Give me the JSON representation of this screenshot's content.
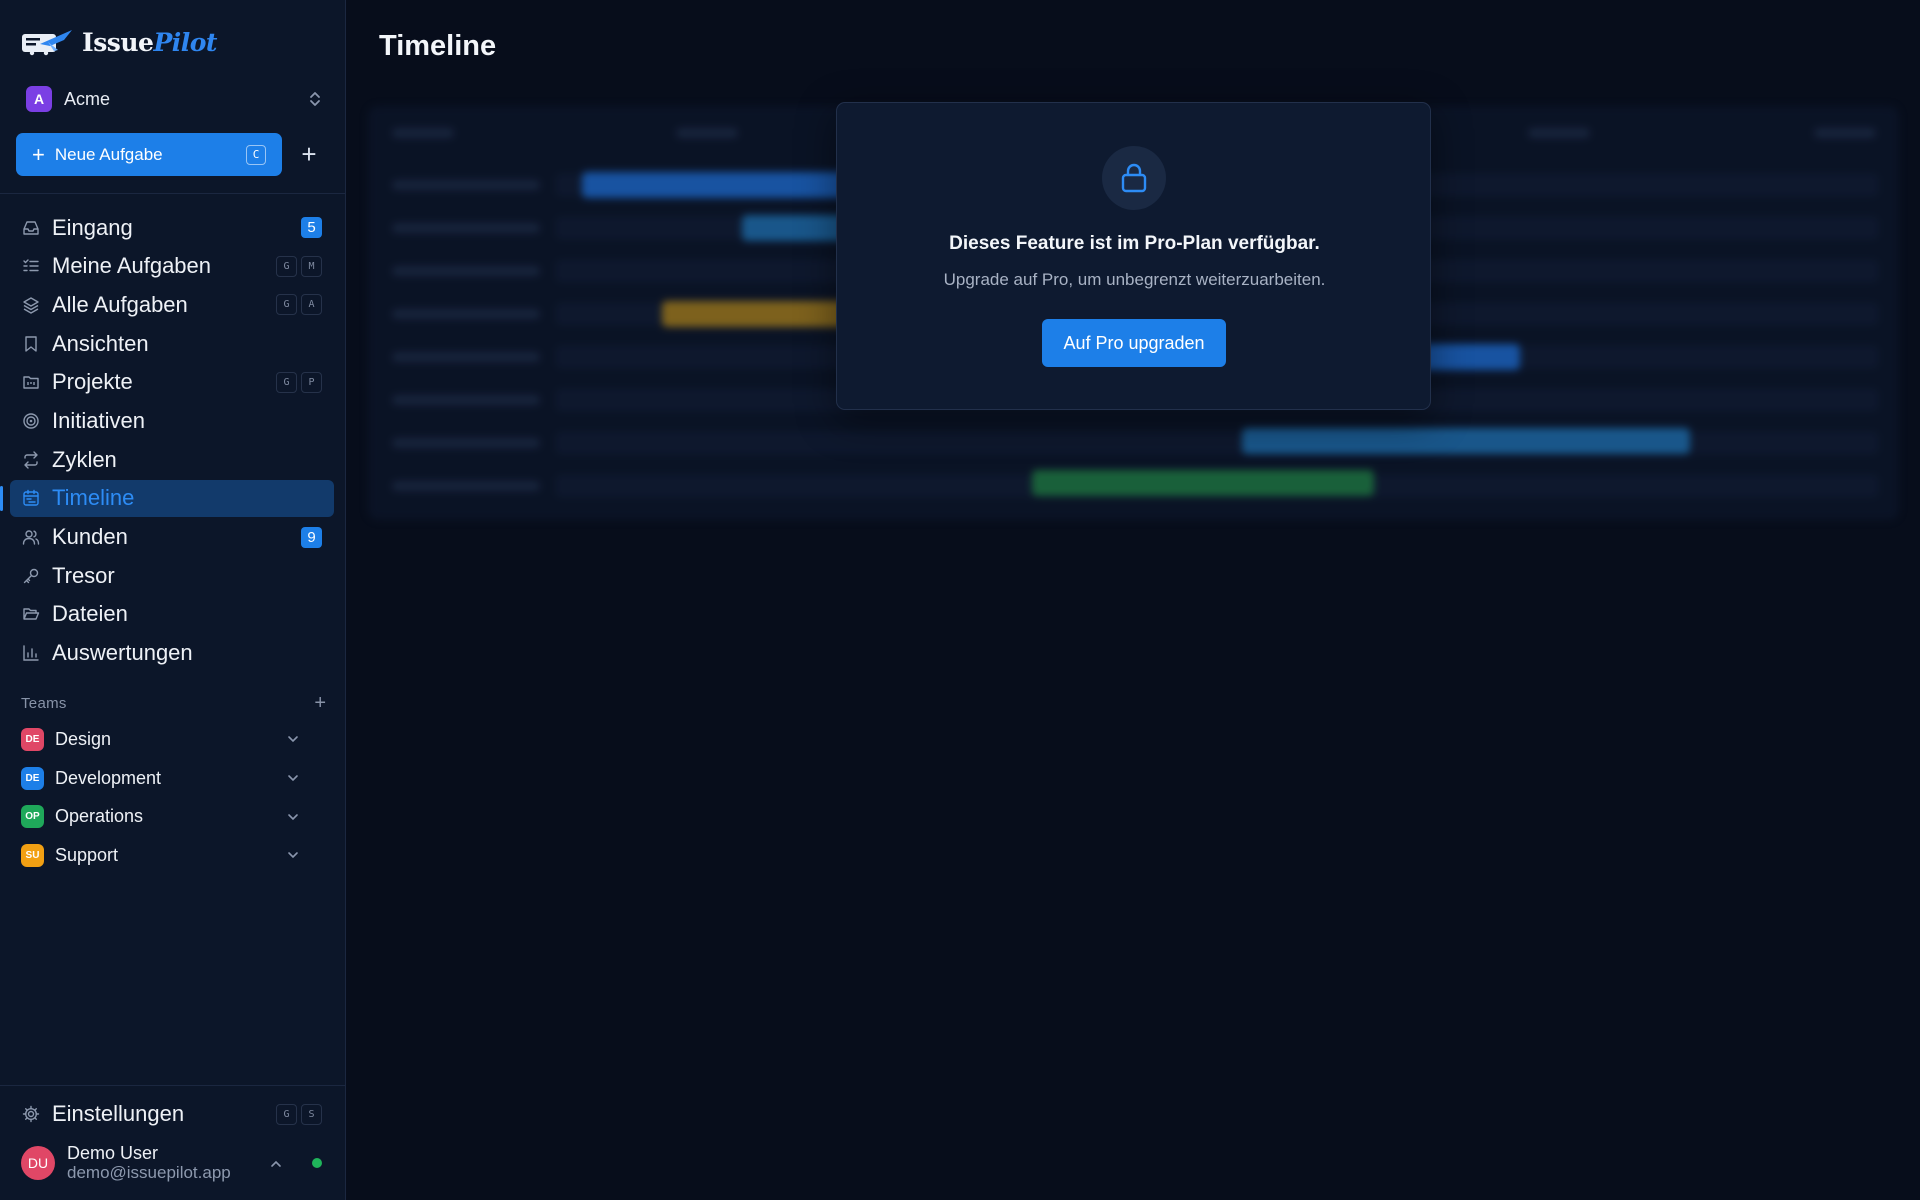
{
  "brand": {
    "name_part1": "Issue",
    "name_part2": "Pilot"
  },
  "workspace": {
    "initial": "A",
    "name": "Acme"
  },
  "new_task": {
    "label": "Neue Aufgabe",
    "shortcut": "C"
  },
  "nav": [
    {
      "id": "inbox",
      "label": "Eingang",
      "icon": "inbox-icon",
      "count": "5"
    },
    {
      "id": "my-tasks",
      "label": "Meine Aufgaben",
      "icon": "list-icon",
      "keys": [
        "G",
        "M"
      ]
    },
    {
      "id": "all-tasks",
      "label": "Alle Aufgaben",
      "icon": "layers-icon",
      "keys": [
        "G",
        "A"
      ]
    },
    {
      "id": "views",
      "label": "Ansichten",
      "icon": "bookmark-icon"
    },
    {
      "id": "projects",
      "label": "Projekte",
      "icon": "folder-kanban-icon",
      "keys": [
        "G",
        "P"
      ]
    },
    {
      "id": "initiatives",
      "label": "Initiativen",
      "icon": "target-icon"
    },
    {
      "id": "cycles",
      "label": "Zyklen",
      "icon": "repeat-icon"
    },
    {
      "id": "timeline",
      "label": "Timeline",
      "icon": "calendar-icon",
      "active": true
    },
    {
      "id": "customers",
      "label": "Kunden",
      "icon": "users-icon",
      "count": "9"
    },
    {
      "id": "vault",
      "label": "Tresor",
      "icon": "key-icon"
    },
    {
      "id": "files",
      "label": "Dateien",
      "icon": "folder-open-icon"
    },
    {
      "id": "reports",
      "label": "Auswertungen",
      "icon": "bar-chart-icon"
    }
  ],
  "teams": {
    "heading": "Teams",
    "items": [
      {
        "initials": "DE",
        "name": "Design",
        "color": "#e04766"
      },
      {
        "initials": "DE",
        "name": "Development",
        "color": "#1d7fe8"
      },
      {
        "initials": "OP",
        "name": "Operations",
        "color": "#1fa85a"
      },
      {
        "initials": "SU",
        "name": "Support",
        "color": "#f2a013"
      }
    ]
  },
  "settings": {
    "label": "Einstellungen",
    "keys": [
      "G",
      "S"
    ]
  },
  "user": {
    "initials": "DU",
    "name": "Demo User",
    "email": "demo@issuepilot.app",
    "status_color": "#1fb45a"
  },
  "page": {
    "title": "Timeline"
  },
  "upgrade_modal": {
    "title": "Dieses Feature ist im Pro-Plan verfügbar.",
    "subtitle": "Upgrade auf Pro, um unbegrenzt weiterzuarbeiten.",
    "button": "Auf Pro upgraden"
  },
  "colors": {
    "accent": "#1d7fe8",
    "background": "#070d1b",
    "sidebar": "#0c1629"
  }
}
